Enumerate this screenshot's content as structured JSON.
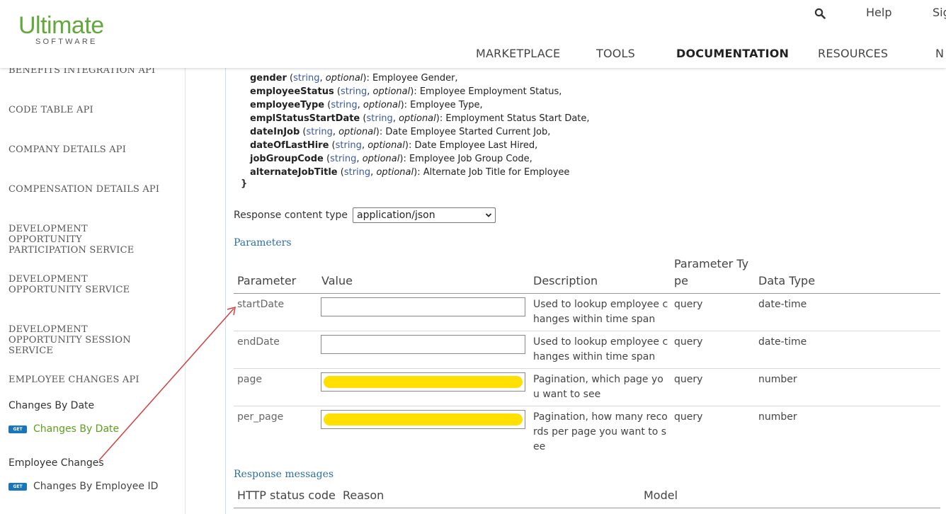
{
  "header": {
    "logo_main": "Ultimate",
    "logo_sub": "SOFTWARE",
    "util_links": [
      "Help",
      "Sig"
    ],
    "nav": [
      "MARKETPLACE",
      "TOOLS",
      "DOCUMENTATION",
      "RESOURCES",
      "N"
    ],
    "active_nav": "DOCUMENTATION"
  },
  "sidebar": {
    "sections": [
      "BENEFITS INTEGRATION API",
      "CODE TABLE API",
      "COMPANY DETAILS API",
      "COMPENSATION DETAILS API",
      "DEVELOPMENT OPPORTUNITY PARTICIPATION SERVICE",
      "DEVELOPMENT OPPORTUNITY SERVICE",
      "DEVELOPMENT OPPORTUNITY SESSION SERVICE",
      "EMPLOYEE CHANGES API"
    ],
    "subgroups": [
      "Changes By Date",
      "Employee Changes"
    ],
    "operations": [
      {
        "method": "GET",
        "label": "Changes By Date"
      },
      {
        "method": "GET",
        "label": "Changes By Employee ID"
      }
    ]
  },
  "model": {
    "fields": [
      {
        "name": "gender",
        "type": "string",
        "opt": "optional",
        "desc": ": Employee Gender,"
      },
      {
        "name": "employeeStatus",
        "type": "string",
        "opt": "optional",
        "desc": ": Employee Employment Status,"
      },
      {
        "name": "employeeType",
        "type": "string",
        "opt": "optional",
        "desc": ": Employee Type,"
      },
      {
        "name": "emplStatusStartDate",
        "type": "string",
        "opt": "optional",
        "desc": ": Employment Status Start Date,"
      },
      {
        "name": "dateInJob",
        "type": "string",
        "opt": "optional",
        "desc": ": Date Employee Started Current Job,"
      },
      {
        "name": "dateOfLastHire",
        "type": "string",
        "opt": "optional",
        "desc": ": Date Employee Last Hired,"
      },
      {
        "name": "jobGroupCode",
        "type": "string",
        "opt": "optional",
        "desc": ": Employee Job Group Code,"
      },
      {
        "name": "alternateJobTitle",
        "type": "string",
        "opt": "optional",
        "desc": ": Alternate Job Title for Employee"
      }
    ],
    "closing_brace": "}"
  },
  "response_content": {
    "label": "Response content type",
    "selected": "application/json"
  },
  "parameters": {
    "heading": "Parameters",
    "columns": [
      "Parameter",
      "Value",
      "Description",
      "Parameter Ty\npe",
      "Data Type"
    ],
    "rows": [
      {
        "name": "startDate",
        "value": "",
        "desc": "Used to lookup employee changes within time span",
        "ptype": "query",
        "dtype": "date-time"
      },
      {
        "name": "endDate",
        "value": "",
        "desc": "Used to lookup employee changes within time span",
        "ptype": "query",
        "dtype": "date-time"
      },
      {
        "name": "page",
        "value": "",
        "desc": "Pagination, which page you want to see",
        "ptype": "query",
        "dtype": "number"
      },
      {
        "name": "per_page",
        "value": "",
        "desc": "Pagination, how many records per page you want to see",
        "ptype": "query",
        "dtype": "number"
      }
    ]
  },
  "response_messages": {
    "heading": "Response messages",
    "columns": [
      "HTTP status code",
      "Reason",
      "Model"
    ]
  },
  "colors": {
    "logo_green": "#63a83b",
    "link_blue": "#2e6da4",
    "type_blue": "#3b59a0",
    "get_badge": "#1b75bb",
    "op_green": "#5ba11b",
    "highlight_yellow": "#ffe000",
    "annotation_red": "#d04040"
  }
}
